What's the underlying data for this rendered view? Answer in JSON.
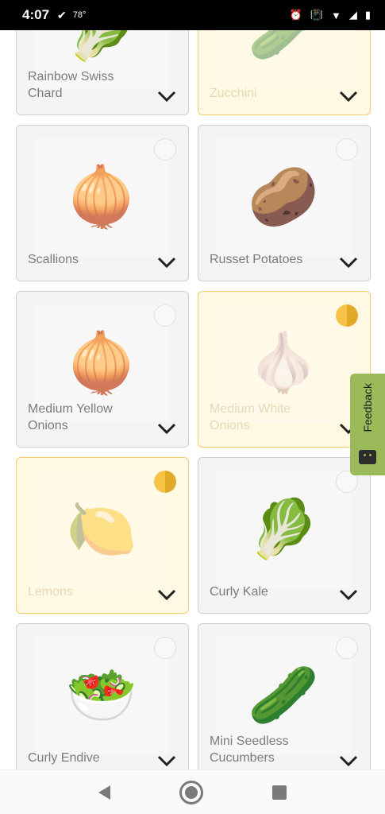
{
  "status_bar": {
    "time": "4:07",
    "check_mark": "✔",
    "temperature": "78°",
    "icons": [
      "alarm-icon",
      "vibrate-icon",
      "wifi-icon",
      "signal-icon",
      "battery-icon"
    ]
  },
  "products": [
    {
      "name": "Rainbow Swiss Chard",
      "emoji": "🥬",
      "selected": false
    },
    {
      "name": "Zucchini",
      "emoji": "🥒",
      "selected": true
    },
    {
      "name": "Scallions",
      "emoji": "🧅",
      "selected": false
    },
    {
      "name": "Russet Potatoes",
      "emoji": "🥔",
      "selected": false
    },
    {
      "name": "Medium Yellow Onions",
      "emoji": "🧅",
      "selected": false
    },
    {
      "name": "Medium White Onions",
      "emoji": "🧄",
      "selected": true
    },
    {
      "name": "Lemons",
      "emoji": "🍋",
      "selected": true
    },
    {
      "name": "Curly Kale",
      "emoji": "🥬",
      "selected": false
    },
    {
      "name": "Curly Endive",
      "emoji": "🥗",
      "selected": false
    },
    {
      "name": "Mini Seedless Cucumbers",
      "emoji": "🥒",
      "selected": false
    }
  ],
  "feedback": {
    "label": "Feedback"
  },
  "colors": {
    "selected_bg": "#fff8e3",
    "selected_border": "#f1cf6d",
    "feedback_green": "#9bbb5a",
    "radio_yellow": "#f6c346"
  }
}
